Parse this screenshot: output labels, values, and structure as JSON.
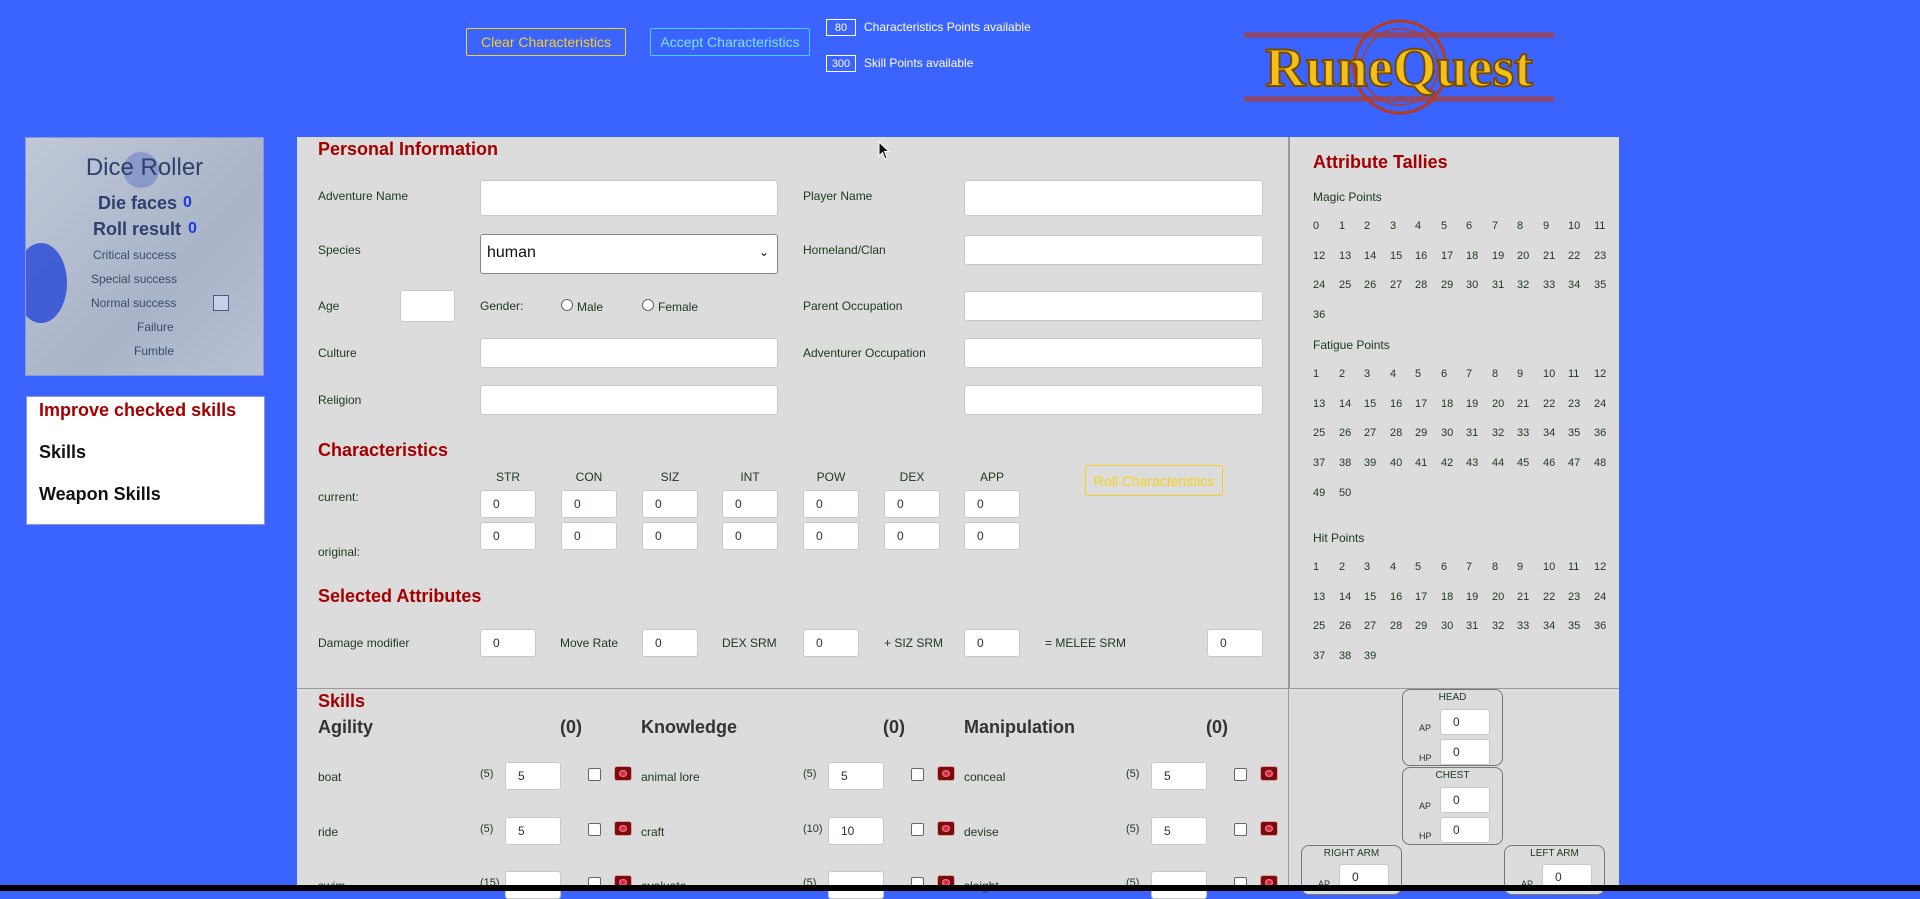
{
  "toolbar": {
    "clear_label": "Clear Characteristics",
    "accept_label": "Accept Characteristics",
    "char_points": "80",
    "char_points_label": "Characteristics Points available",
    "skill_points": "300",
    "skill_points_label": "Skill Points available"
  },
  "dice": {
    "title": "Dice Roller",
    "faces_label": "Die faces",
    "faces_value": "0",
    "roll_label": "Roll result",
    "roll_value": "0",
    "results": [
      "Critical success",
      "Special success",
      "Normal success",
      "Failure",
      "Fumble"
    ]
  },
  "menu": {
    "improve": "Improve checked skills",
    "skills": "Skills",
    "weapon": "Weapon Skills"
  },
  "personal": {
    "heading": "Personal Information",
    "adventure_name": "Adventure Name",
    "player_name": "Player Name",
    "species": "Species",
    "species_value": "human",
    "homeland": "Homeland/Clan",
    "age": "Age",
    "gender": "Gender:",
    "male": "Male",
    "female": "Female",
    "parent_occ": "Parent Occupation",
    "culture": "Culture",
    "adv_occ": "Adventurer Occupation",
    "religion": "Religion"
  },
  "characteristics": {
    "heading": "Characteristics",
    "current": "current:",
    "original": "original:",
    "roll_label": "Roll Characteristics",
    "cols": [
      "STR",
      "CON",
      "SIZ",
      "INT",
      "POW",
      "DEX",
      "APP"
    ],
    "current_vals": [
      "0",
      "0",
      "0",
      "0",
      "0",
      "0",
      "0"
    ],
    "original_vals": [
      "0",
      "0",
      "0",
      "0",
      "0",
      "0",
      "0"
    ]
  },
  "attributes": {
    "heading": "Selected Attributes",
    "damage_modifier": "Damage modifier",
    "damage_value": "0",
    "move_rate": "Move Rate",
    "move_value": "0",
    "dex_srm": "DEX SRM",
    "dex_value": "0",
    "siz_srm": "+ SIZ SRM",
    "siz_value": "0",
    "melee_srm": "= MELEE SRM",
    "melee_value": "0"
  },
  "tallies": {
    "heading": "Attribute Tallies",
    "magic": "Magic Points",
    "fatigue": "Fatigue Points",
    "hit": "Hit Points"
  },
  "skills": {
    "heading": "Skills",
    "groups": [
      {
        "name": "Agility",
        "count": "(0)",
        "items": [
          {
            "name": "boat",
            "base": "(5)",
            "value": "5"
          },
          {
            "name": "ride",
            "base": "(5)",
            "value": "5"
          },
          {
            "name": "swim",
            "base": "(15)",
            "value": ""
          }
        ]
      },
      {
        "name": "Knowledge",
        "count": "(0)",
        "items": [
          {
            "name": "animal lore",
            "base": "(5)",
            "value": "5"
          },
          {
            "name": "craft",
            "base": "(10)",
            "value": "10"
          },
          {
            "name": "evaluate",
            "base": "(5)",
            "value": ""
          }
        ]
      },
      {
        "name": "Manipulation",
        "count": "(0)",
        "items": [
          {
            "name": "conceal",
            "base": "(5)",
            "value": "5"
          },
          {
            "name": "devise",
            "base": "(5)",
            "value": "5"
          },
          {
            "name": "sleight",
            "base": "(5)",
            "value": ""
          }
        ]
      }
    ]
  },
  "body": {
    "head": "HEAD",
    "chest": "CHEST",
    "right_arm": "RIGHT ARM",
    "left_arm": "LEFT ARM",
    "ap": "AP",
    "hp": "HP",
    "head_ap": "0",
    "head_hp": "0",
    "chest_ap": "0",
    "chest_hp": "0",
    "rarm_ap": "0",
    "larm_ap": "0"
  }
}
